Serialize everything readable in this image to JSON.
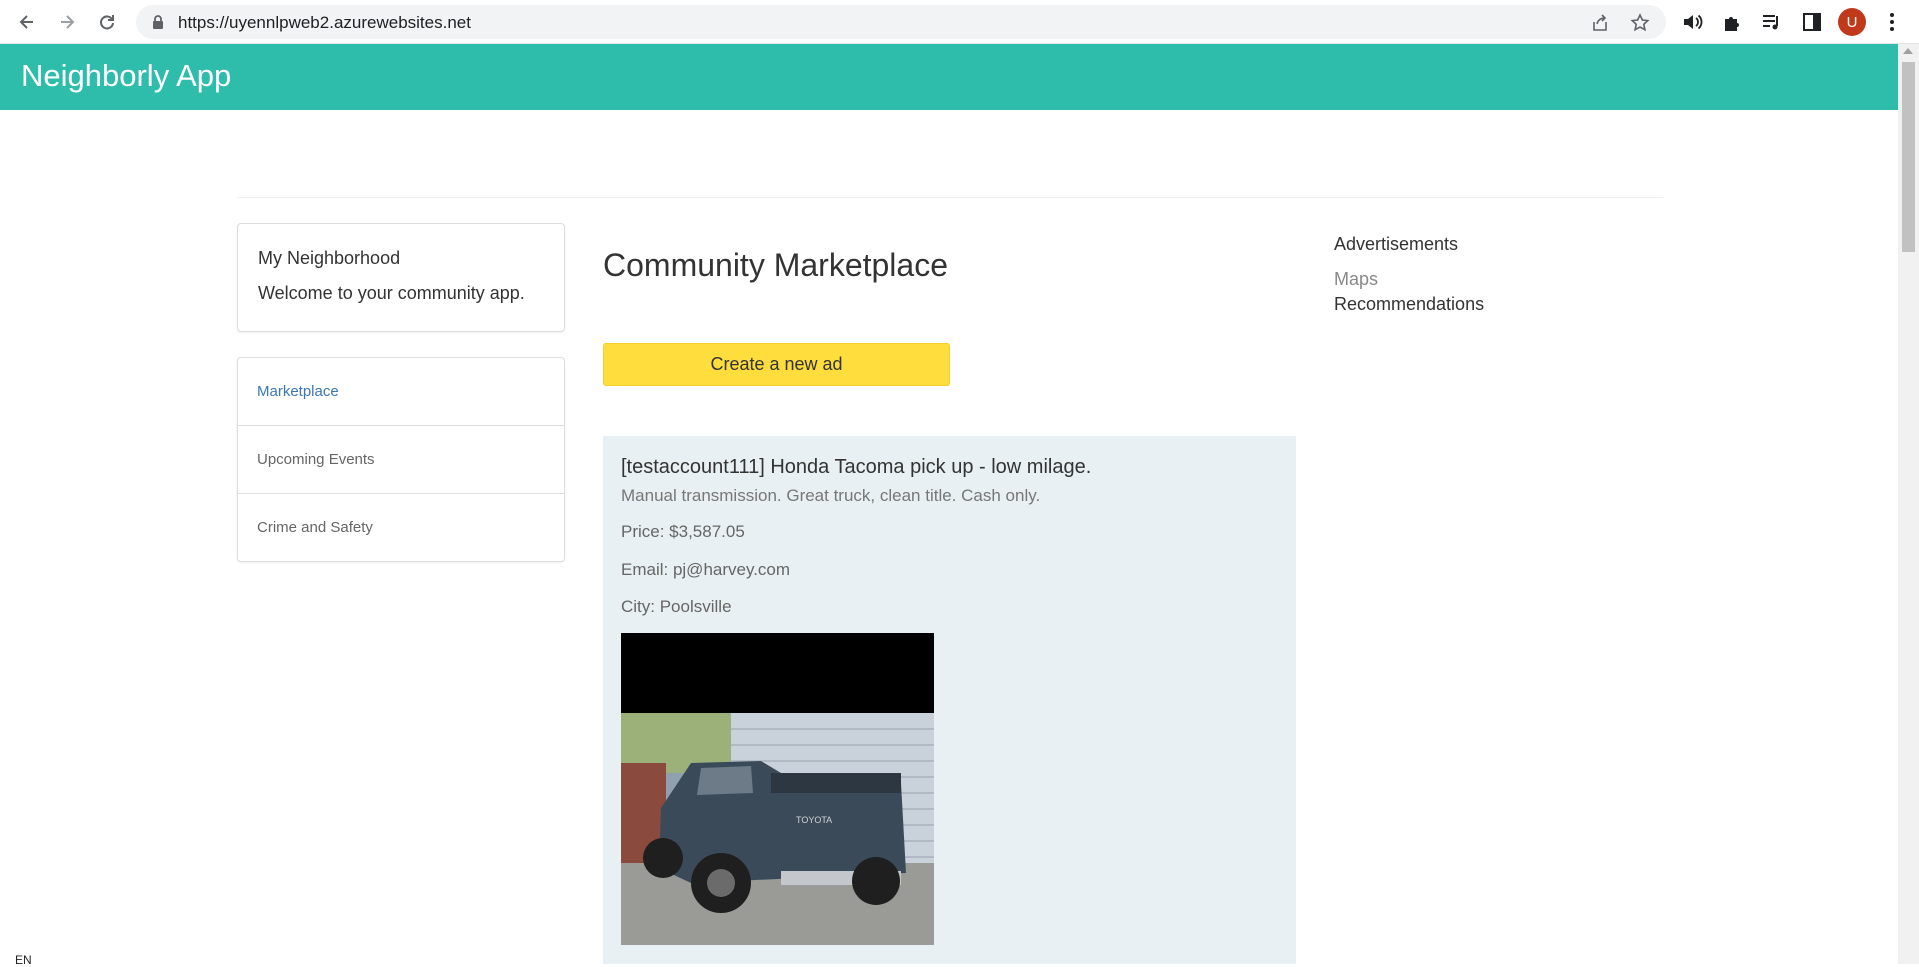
{
  "browser": {
    "url": "https://uyennlpweb2.azurewebsites.net",
    "profile_initial": "U",
    "icons": [
      "back-icon",
      "forward-icon",
      "reload-icon",
      "lock-icon",
      "share-icon",
      "star-icon",
      "volume-icon",
      "extensions-icon",
      "media-icon",
      "sidepanel-icon",
      "menu-icon"
    ]
  },
  "header": {
    "brand": "Neighborly App"
  },
  "sidebar": {
    "neighborhood_title": "My Neighborhood",
    "neighborhood_text": "Welcome to your community app.",
    "menu": [
      {
        "label": "Marketplace",
        "active": true
      },
      {
        "label": "Upcoming Events",
        "active": false
      },
      {
        "label": "Crime and Safety",
        "active": false
      }
    ]
  },
  "main": {
    "title": "Community Marketplace",
    "create_button": "Create a new ad",
    "ads": [
      {
        "title": "[testaccount111] Honda Tacoma pick up - low milage.",
        "description": "Manual transmission. Great truck, clean title. Cash only.",
        "price": "Price: $3,587.05",
        "email": "Email: pj@harvey.com",
        "city": "City: Poolsville"
      }
    ]
  },
  "right": {
    "ads_title": "Advertisements",
    "maps": "Maps",
    "recommendations": "Recommendations"
  },
  "footer": {
    "language": "EN"
  },
  "colors": {
    "header": "#2ebdaa",
    "create_button": "#ffdd3c",
    "card_bg": "#e8f0f4",
    "active_link": "#3a77b6"
  }
}
